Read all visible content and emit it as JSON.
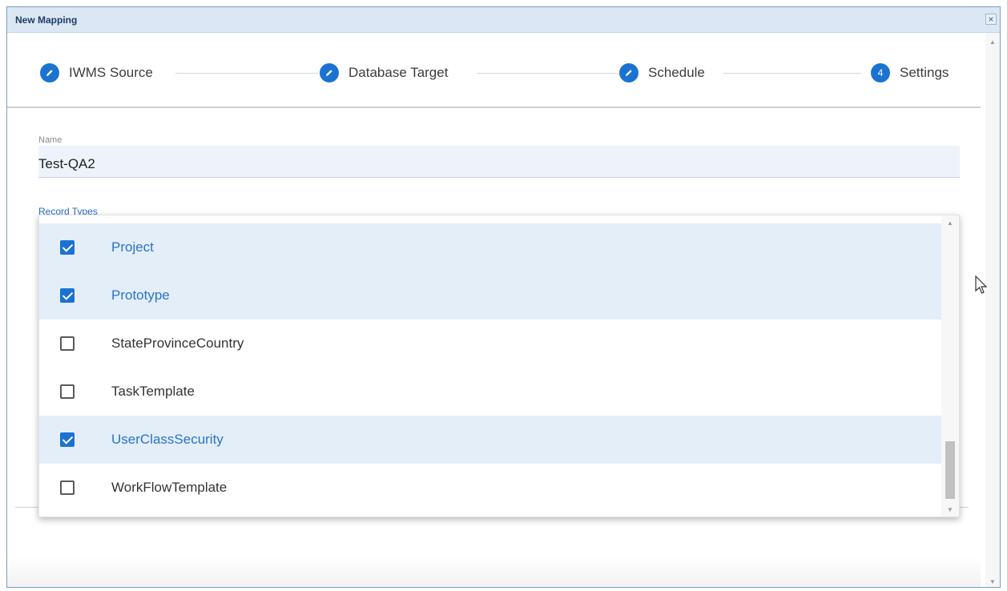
{
  "dialog": {
    "title": "New Mapping",
    "close_label": "×"
  },
  "stepper": {
    "steps": [
      {
        "label": "IWMS Source",
        "icon": "pencil-icon"
      },
      {
        "label": "Database Target",
        "icon": "pencil-icon"
      },
      {
        "label": "Schedule",
        "icon": "pencil-icon"
      },
      {
        "label": "Settings",
        "number": "4"
      }
    ]
  },
  "form": {
    "name_label": "Name",
    "name_value": "Test-QA2",
    "record_types_label": "Record Types"
  },
  "record_types": [
    {
      "label": "Project",
      "checked": true
    },
    {
      "label": "Prototype",
      "checked": true
    },
    {
      "label": "StateProvinceCountry",
      "checked": false
    },
    {
      "label": "TaskTemplate",
      "checked": false
    },
    {
      "label": "UserClassSecurity",
      "checked": true
    },
    {
      "label": "WorkFlowTemplate",
      "checked": false
    }
  ],
  "colors": {
    "accent": "#1a73d1",
    "selected_row": "#e3eef9",
    "titlebar": "#dbe7f4"
  }
}
